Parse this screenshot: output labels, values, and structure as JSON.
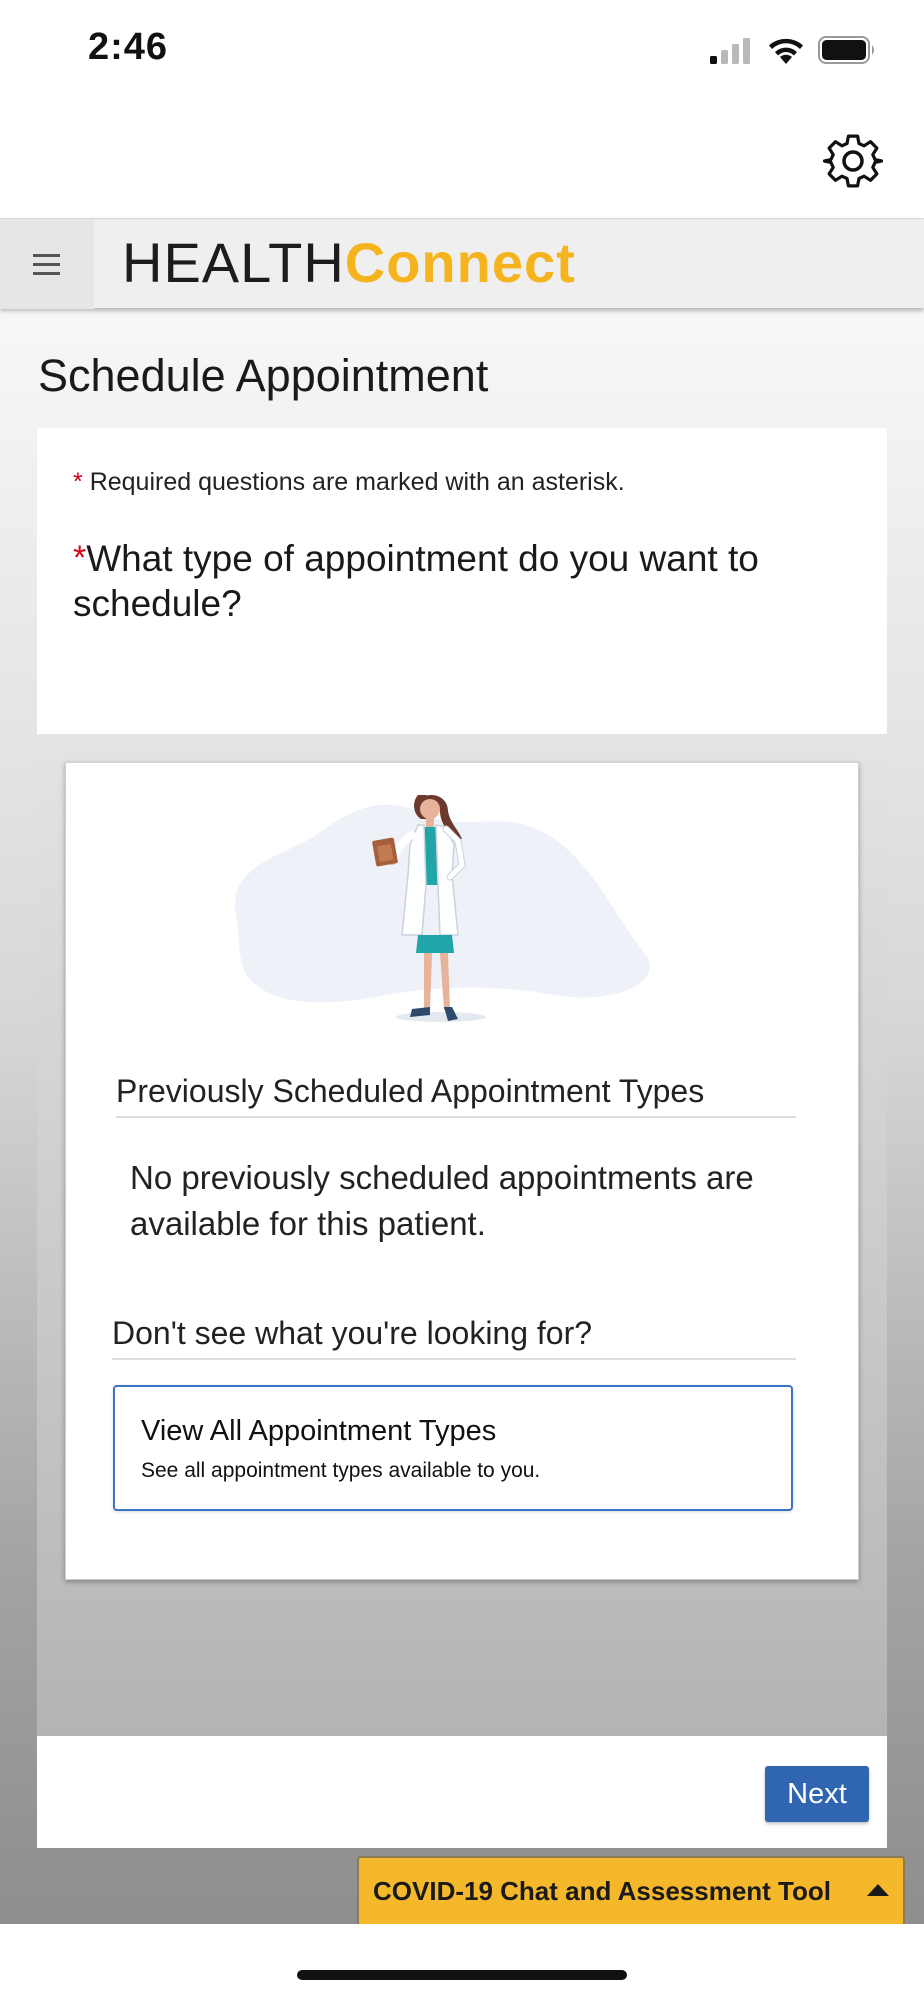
{
  "status_bar": {
    "time": "2:46",
    "icons": [
      "cellular-signal-icon",
      "wifi-icon",
      "battery-icon"
    ]
  },
  "topbar": {
    "icons": [
      "gear-icon"
    ]
  },
  "nav": {
    "menu_icon": "hamburger-menu-icon",
    "logo_part1": "HEALTH",
    "logo_part2": "Connect",
    "logo_accent_color": "#f5b41d"
  },
  "page": {
    "title": "Schedule Appointment"
  },
  "form": {
    "required_star": "*",
    "required_note": "Required questions are marked with an asterisk.",
    "question": "What type of appointment do you want to schedule?",
    "illustration": "doctor-with-clipboard-illustration",
    "previous_title": "Previously Scheduled Appointment Types",
    "no_previous_text": "No previously scheduled appointments are available for this patient.",
    "dont_see_title": "Don't see what you're looking for?",
    "view_all": {
      "title": "View All Appointment Types",
      "subtitle": "See all appointment types available to you."
    },
    "next_label": "Next"
  },
  "covid_tool": {
    "label": "COVID-19 Chat and Assessment Tool",
    "icon": "caret-up-icon",
    "color": "#f5b82b"
  },
  "colors": {
    "primary_button": "#2f65b1",
    "required_asterisk": "#d0021b"
  }
}
